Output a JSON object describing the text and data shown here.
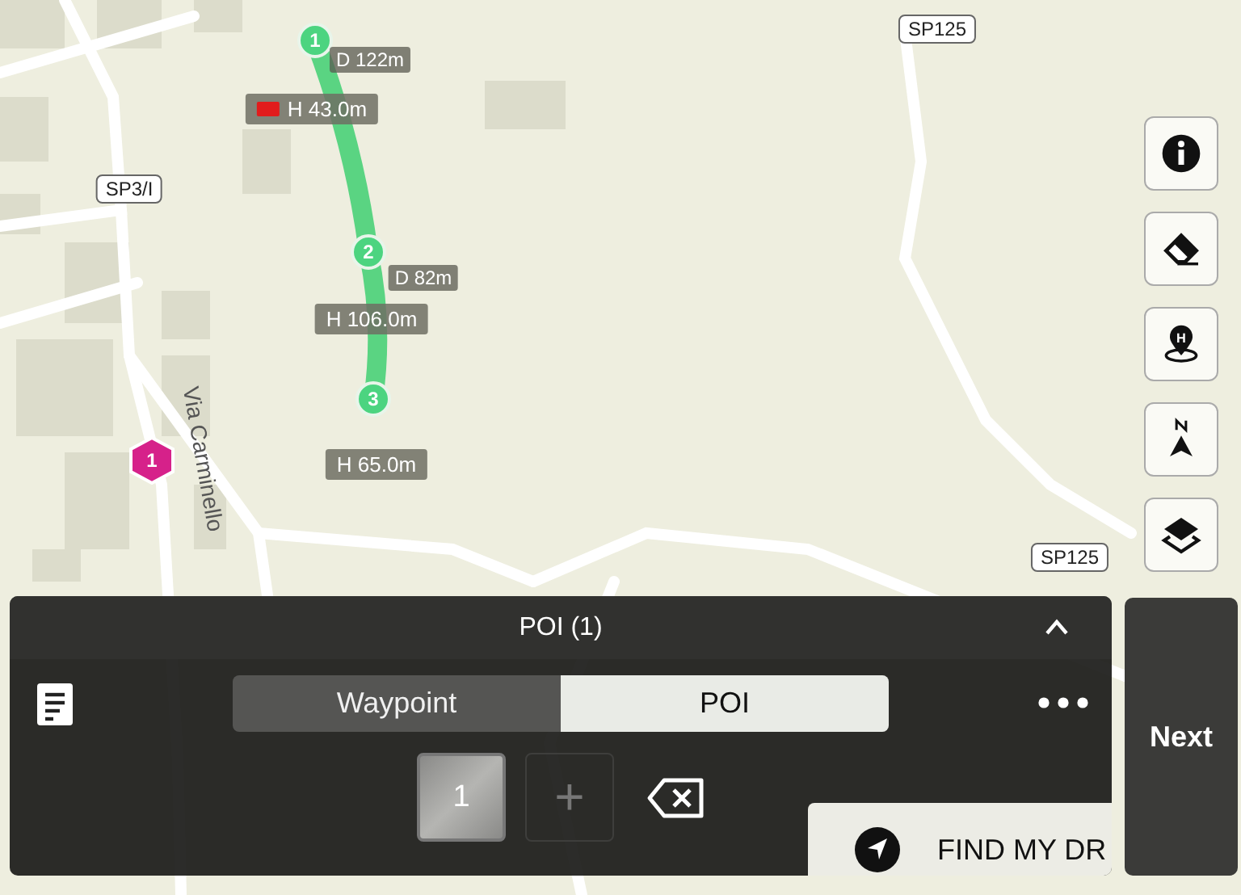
{
  "map": {
    "road_labels": [
      "SP125",
      "SP3/I",
      "SP125"
    ],
    "street_labels": [
      "Via Carminello"
    ],
    "waypoints": [
      {
        "label": "1",
        "distance": "D 122m",
        "height": "H 43.0m",
        "camera": true
      },
      {
        "label": "2",
        "distance": "D 82m",
        "height": "H 106.0m",
        "camera": false
      },
      {
        "label": "3",
        "height": "H 65.0m",
        "camera": false
      }
    ],
    "pois": [
      {
        "label": "1",
        "color": "#d6218a"
      }
    ]
  },
  "toolbar": [
    {
      "kind": "info"
    },
    {
      "kind": "eraser"
    },
    {
      "kind": "home",
      "symbol": "H"
    },
    {
      "kind": "north"
    },
    {
      "kind": "layers"
    }
  ],
  "panel": {
    "title": "POI (1)",
    "expanded": true,
    "tabs": [
      {
        "label": "Waypoint",
        "selected": false
      },
      {
        "label": "POI",
        "selected": true
      }
    ],
    "points": [
      {
        "label": "1",
        "selected": true
      }
    ],
    "add_symbol": "+",
    "find_card": "FIND MY DR",
    "next": "Next"
  }
}
